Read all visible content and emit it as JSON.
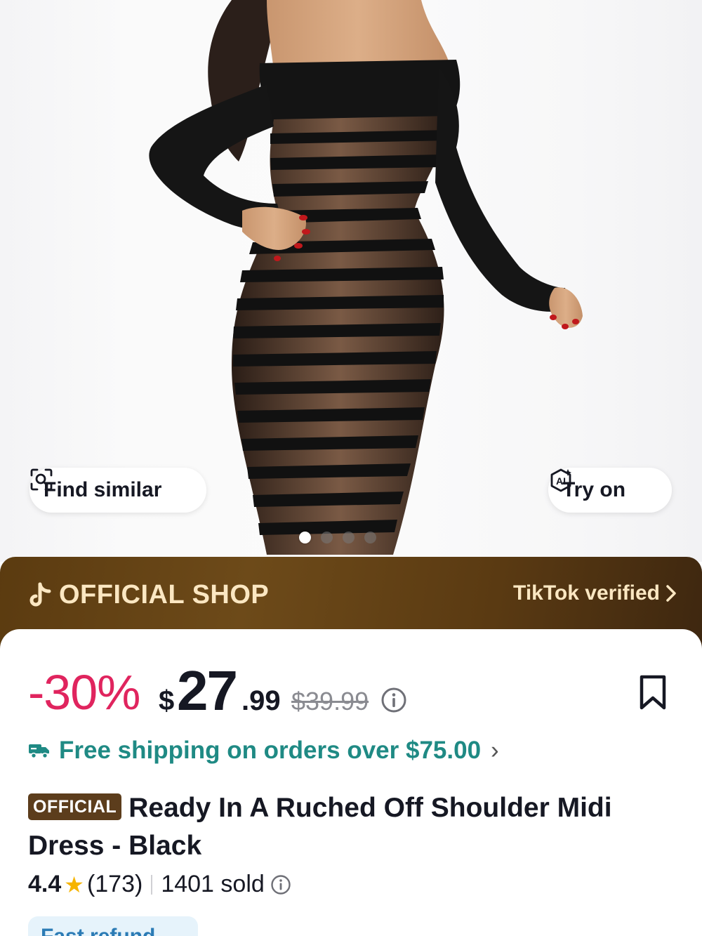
{
  "product_image": {
    "alt": "",
    "dots": {
      "count": 4,
      "active_index": 0
    },
    "find_similar_label": "Find similar",
    "try_on_label": "Try on",
    "try_on_icon_text": "AI"
  },
  "shop": {
    "label": "OFFICIAL SHOP",
    "verified_label": "TikTok verified"
  },
  "price": {
    "discount": "-30%",
    "currency": "$",
    "integer": "27",
    "decimal": ".99",
    "original": "$39.99"
  },
  "shipping": {
    "text": "Free shipping on orders over $75.00",
    "chevron": "›"
  },
  "product": {
    "badge": "OFFICIAL",
    "title": "Ready In A Ruched Off Shoulder Midi Dress - Black"
  },
  "rating": {
    "score": "4.4",
    "star": "★",
    "count": "(173)",
    "sold": "1401 sold"
  },
  "bottom_tag": {
    "text": "Fast refund"
  },
  "colors": {
    "discount": "#e0245e",
    "shipping": "#1f8a84",
    "shop_band": "#6d4a19",
    "shop_text": "#fbe7c2",
    "star": "#f6b400",
    "badge": "#5c3d1c"
  },
  "icons": {
    "find_similar": "image-search-icon",
    "try_on": "ai-sparkle-icon",
    "tiktok": "tiktok-logo-icon",
    "verified_chevron": "chevron-right-icon",
    "price_info": "info-circle-icon",
    "bookmark": "bookmark-icon",
    "shipping": "truck-icon",
    "sold_info": "info-circle-icon"
  }
}
